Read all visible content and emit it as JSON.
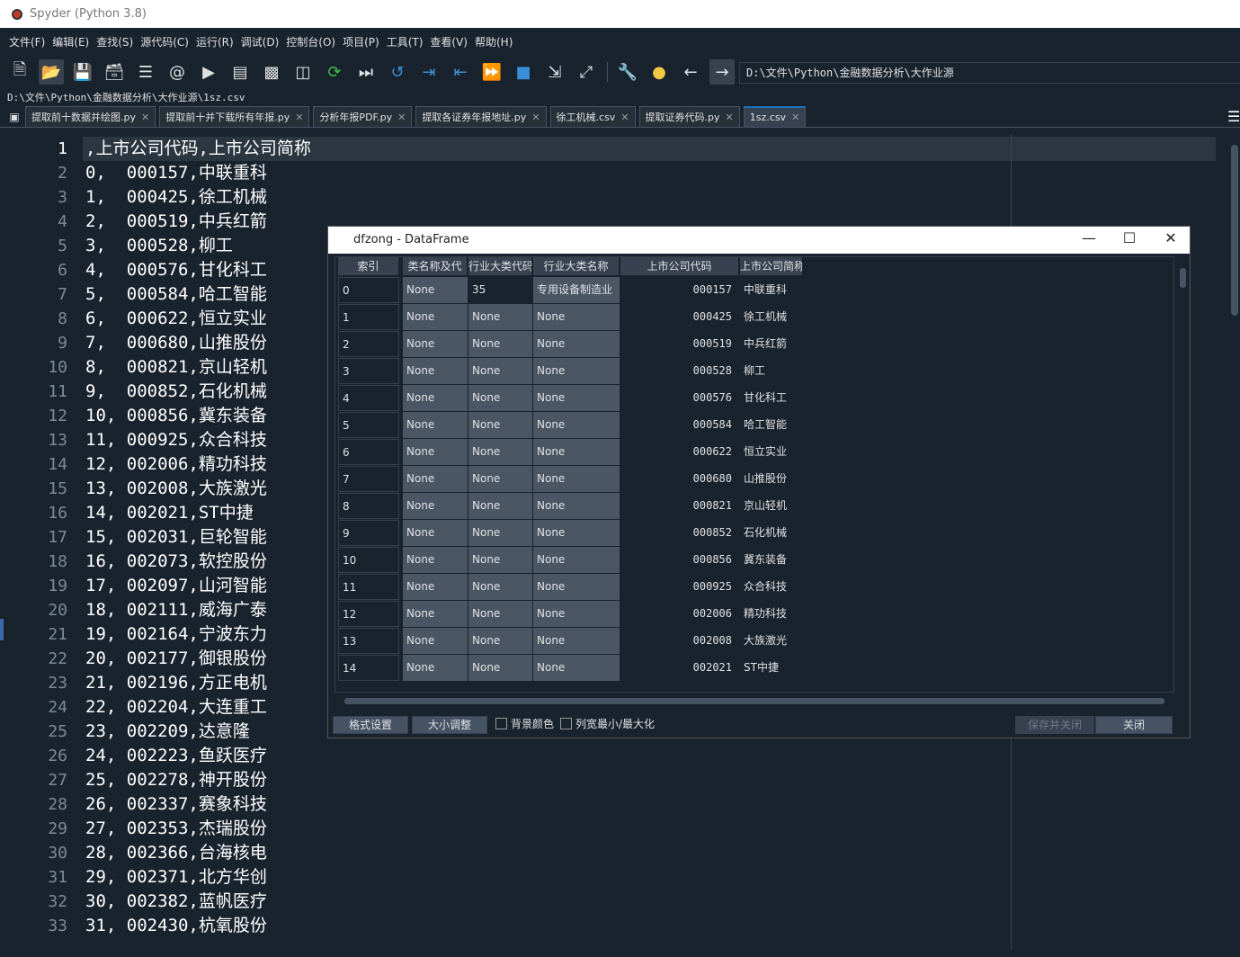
{
  "window": {
    "title": "Spyder (Python 3.8)"
  },
  "menu": [
    "文件(F)",
    "编辑(E)",
    "查找(S)",
    "源代码(C)",
    "运行(R)",
    "调试(D)",
    "控制台(O)",
    "项目(P)",
    "工具(T)",
    "查看(V)",
    "帮助(H)"
  ],
  "toolbar": {
    "path": "D:\\文件\\Python\\金融数据分析\\大作业源"
  },
  "filepath": "D:\\文件\\Python\\金融数据分析\\大作业源\\1sz.csv",
  "tabs": [
    "提取前十数据并绘图.py",
    "提取前十并下载所有年报.py",
    "分析年报PDF.py",
    "提取各证券年报地址.py",
    "徐工机械.csv",
    "提取证券代码.py",
    "1sz.csv"
  ],
  "editor": {
    "line_numbers": [
      "1",
      "2",
      "3",
      "4",
      "5",
      "6",
      "7",
      "8",
      "9",
      "10",
      "11",
      "12",
      "13",
      "14",
      "15",
      "16",
      "17",
      "18",
      "19",
      "20",
      "21",
      "22",
      "23",
      "24",
      "25",
      "26",
      "27",
      "28",
      "29",
      "30",
      "31",
      "32",
      "33"
    ],
    "lines": [
      ",上市公司代码,上市公司简称",
      "0,  000157,中联重科",
      "1,  000425,徐工机械",
      "2,  000519,中兵红箭",
      "3,  000528,柳工",
      "4,  000576,甘化科工",
      "5,  000584,哈工智能",
      "6,  000622,恒立实业",
      "7,  000680,山推股份",
      "8,  000821,京山轻机",
      "9,  000852,石化机械",
      "10, 000856,冀东装备",
      "11, 000925,众合科技",
      "12, 002006,精功科技",
      "13, 002008,大族激光",
      "14, 002021,ST中捷",
      "15, 002031,巨轮智能",
      "16, 002073,软控股份",
      "17, 002097,山河智能",
      "18, 002111,威海广泰",
      "19, 002164,宁波东力",
      "20, 002177,御银股份",
      "21, 002196,方正电机",
      "22, 002204,大连重工",
      "23, 002209,达意隆",
      "24, 002223,鱼跃医疗",
      "25, 002278,神开股份",
      "26, 002337,赛象科技",
      "27, 002353,杰瑞股份",
      "28, 002366,台海核电",
      "29, 002371,北方华创",
      "30, 002382,蓝帆医疗",
      "31, 002430,杭氧股份"
    ]
  },
  "dialog": {
    "title": "dfzong - DataFrame",
    "headers": [
      "索引",
      "类名称及代",
      "行业大类代码",
      "行业大类名称",
      "上市公司代码",
      "上市公司简称"
    ],
    "rows": [
      [
        "0",
        "None",
        "35",
        "专用设备制造业",
        "000157",
        "中联重科"
      ],
      [
        "1",
        "None",
        "None",
        "None",
        "000425",
        "徐工机械"
      ],
      [
        "2",
        "None",
        "None",
        "None",
        "000519",
        "中兵红箭"
      ],
      [
        "3",
        "None",
        "None",
        "None",
        "000528",
        "柳工"
      ],
      [
        "4",
        "None",
        "None",
        "None",
        "000576",
        "甘化科工"
      ],
      [
        "5",
        "None",
        "None",
        "None",
        "000584",
        "哈工智能"
      ],
      [
        "6",
        "None",
        "None",
        "None",
        "000622",
        "恒立实业"
      ],
      [
        "7",
        "None",
        "None",
        "None",
        "000680",
        "山推股份"
      ],
      [
        "8",
        "None",
        "None",
        "None",
        "000821",
        "京山轻机"
      ],
      [
        "9",
        "None",
        "None",
        "None",
        "000852",
        "石化机械"
      ],
      [
        "10",
        "None",
        "None",
        "None",
        "000856",
        "冀东装备"
      ],
      [
        "11",
        "None",
        "None",
        "None",
        "000925",
        "众合科技"
      ],
      [
        "12",
        "None",
        "None",
        "None",
        "002006",
        "精功科技"
      ],
      [
        "13",
        "None",
        "None",
        "None",
        "002008",
        "大族激光"
      ],
      [
        "14",
        "None",
        "None",
        "None",
        "002021",
        "ST中捷"
      ]
    ],
    "buttons": {
      "format": "格式设置",
      "resize": "大小调整",
      "bg_color": "背景颜色",
      "col_minmax": "列宽最小/最大化",
      "save_close": "保存并关闭",
      "close": "关闭"
    }
  }
}
